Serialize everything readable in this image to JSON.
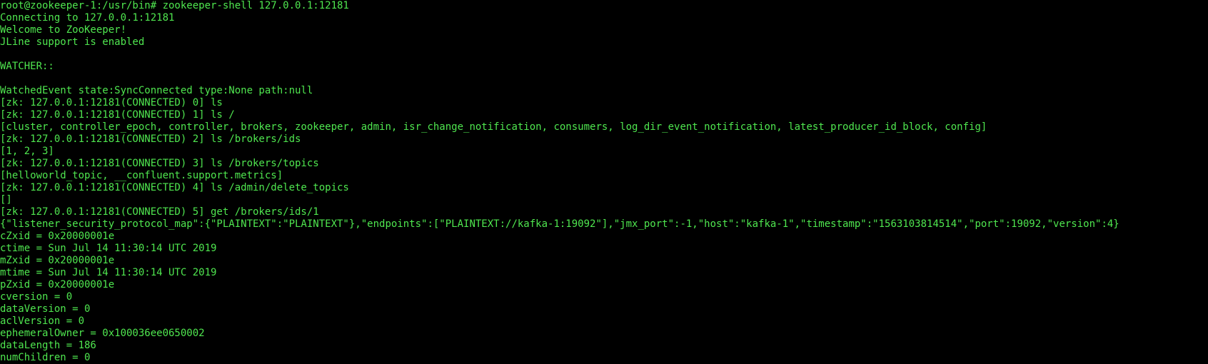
{
  "terminal": {
    "text_color": "#4fe64f",
    "background_color": "#000000",
    "lines": [
      "root@zookeeper-1:/usr/bin# zookeeper-shell 127.0.0.1:12181",
      "Connecting to 127.0.0.1:12181",
      "Welcome to ZooKeeper!",
      "JLine support is enabled",
      "",
      "WATCHER::",
      "",
      "WatchedEvent state:SyncConnected type:None path:null",
      "[zk: 127.0.0.1:12181(CONNECTED) 0] ls",
      "[zk: 127.0.0.1:12181(CONNECTED) 1] ls /",
      "[cluster, controller_epoch, controller, brokers, zookeeper, admin, isr_change_notification, consumers, log_dir_event_notification, latest_producer_id_block, config]",
      "[zk: 127.0.0.1:12181(CONNECTED) 2] ls /brokers/ids",
      "[1, 2, 3]",
      "[zk: 127.0.0.1:12181(CONNECTED) 3] ls /brokers/topics",
      "[helloworld_topic, __confluent.support.metrics]",
      "[zk: 127.0.0.1:12181(CONNECTED) 4] ls /admin/delete_topics",
      "[]",
      "[zk: 127.0.0.1:12181(CONNECTED) 5] get /brokers/ids/1",
      "{\"listener_security_protocol_map\":{\"PLAINTEXT\":\"PLAINTEXT\"},\"endpoints\":[\"PLAINTEXT://kafka-1:19092\"],\"jmx_port\":-1,\"host\":\"kafka-1\",\"timestamp\":\"1563103814514\",\"port\":19092,\"version\":4}",
      "cZxid = 0x20000001e",
      "ctime = Sun Jul 14 11:30:14 UTC 2019",
      "mZxid = 0x20000001e",
      "mtime = Sun Jul 14 11:30:14 UTC 2019",
      "pZxid = 0x20000001e",
      "cversion = 0",
      "dataVersion = 0",
      "aclVersion = 0",
      "ephemeralOwner = 0x100036ee0650002",
      "dataLength = 186",
      "numChildren = 0"
    ]
  }
}
